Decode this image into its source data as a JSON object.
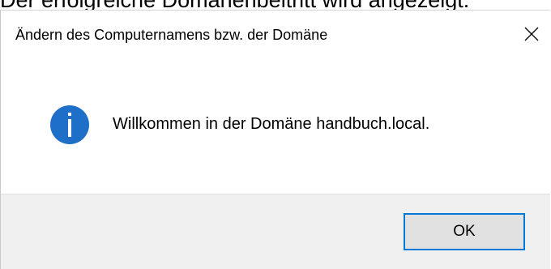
{
  "caption": "Der erfolgreiche Domänenbeitritt wird angezeigt.",
  "dialog": {
    "title": "Ändern des Computernamens bzw. der Domäne",
    "close_glyph": "✕",
    "icon": "info-icon",
    "icon_color": "#1e6fc7",
    "message": "Willkommen in der Domäne handbuch.local.",
    "ok_label": "OK",
    "accent_color": "#0078d7"
  }
}
